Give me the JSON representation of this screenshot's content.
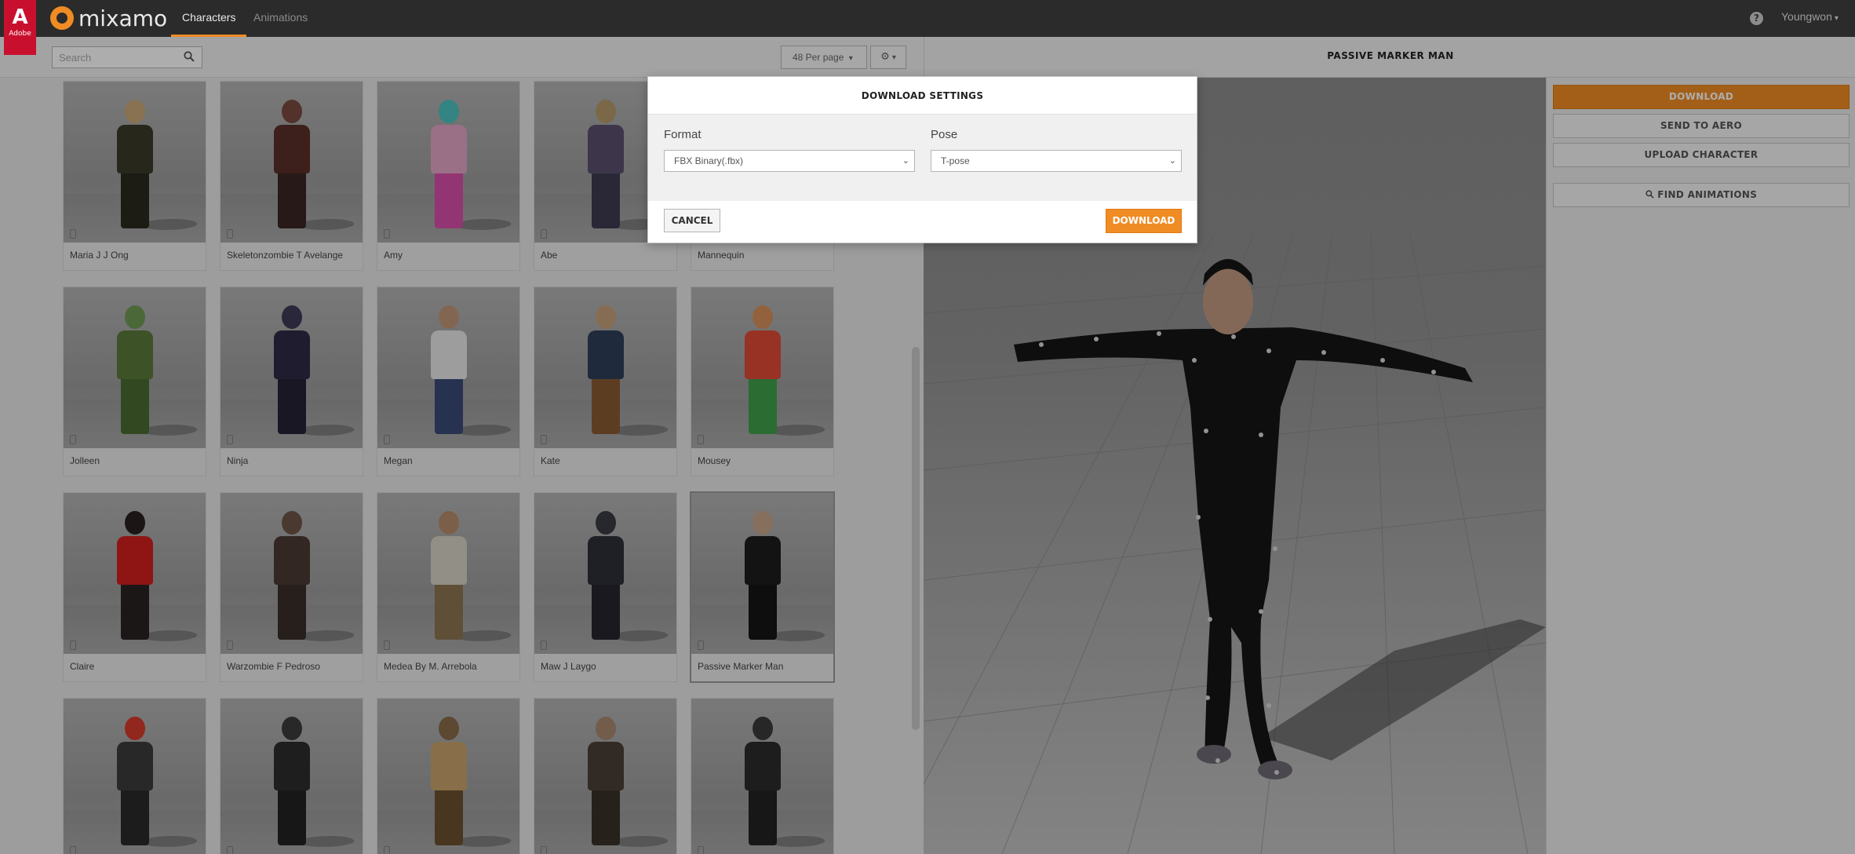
{
  "brand": {
    "adobe_glyph": "A",
    "adobe_word": "Adobe",
    "app_name": "mixamo",
    "accent": "#f08c24"
  },
  "nav": {
    "tabs": [
      {
        "label": "Characters",
        "active": true
      },
      {
        "label": "Animations",
        "active": false
      }
    ],
    "help_glyph": "?",
    "user": "Youngwon",
    "user_caret": "▾"
  },
  "toolbar": {
    "search_placeholder": "Search",
    "per_page": "48 Per page",
    "per_page_caret": "▾",
    "settings_caret": "▾"
  },
  "characters": [
    {
      "name": "Maria J J Ong",
      "colors": [
        "#c9a878",
        "#3a3a2a",
        "#2a2a20"
      ]
    },
    {
      "name": "Skeletonzombie T Avelange",
      "colors": [
        "#7a4a3e",
        "#5b2f28",
        "#3a2622"
      ]
    },
    {
      "name": "Amy",
      "colors": [
        "#4cc3c0",
        "#e3a6c6",
        "#d74fa8"
      ]
    },
    {
      "name": "Abe",
      "colors": [
        "#b49a6b",
        "#5a4e6e",
        "#3f3a52"
      ]
    },
    {
      "name": "Mannequin",
      "colors": [
        "#cfcfcf",
        "#bdbdbd",
        "#a8a8a8"
      ]
    },
    {
      "name": "Jolleen",
      "colors": [
        "#6f9a55",
        "#5a7a3a",
        "#4a6a32"
      ]
    },
    {
      "name": "Ninja",
      "colors": [
        "#3e3a58",
        "#2d2a45",
        "#252236"
      ]
    },
    {
      "name": "Megan",
      "colors": [
        "#c0977a",
        "#e8e8e8",
        "#3a4a78"
      ]
    },
    {
      "name": "Kate",
      "colors": [
        "#c7a07c",
        "#2f3f5a",
        "#8a5a33"
      ]
    },
    {
      "name": "Mousey",
      "colors": [
        "#d7905a",
        "#e04a35",
        "#3fa04a"
      ]
    },
    {
      "name": "Claire",
      "colors": [
        "#2a2020",
        "#d3201f",
        "#2a2222"
      ]
    },
    {
      "name": "Warzombie F Pedroso",
      "colors": [
        "#6e5548",
        "#4a3a34",
        "#3a2f2a"
      ]
    },
    {
      "name": "Medea By M. Arrebola",
      "colors": [
        "#b78d6c",
        "#d8d3c8",
        "#8c7552"
      ]
    },
    {
      "name": "Maw J Laygo",
      "colors": [
        "#3a3a44",
        "#2f2f38",
        "#26262e"
      ]
    },
    {
      "name": "Passive Marker Man",
      "colors": [
        "#c8a48a",
        "#1d1d1d",
        "#151515"
      ],
      "selected": true
    },
    {
      "name": "",
      "colors": [
        "#d63a2c",
        "#3b3b3b",
        "#2a2a2a"
      ]
    },
    {
      "name": "",
      "colors": [
        "#3b3b3b",
        "#2d2d2d",
        "#222222"
      ]
    },
    {
      "name": "",
      "colors": [
        "#8a6a4a",
        "#c9a46c",
        "#6a5030"
      ]
    },
    {
      "name": "",
      "colors": [
        "#a88870",
        "#4a3f36",
        "#3a322a"
      ]
    },
    {
      "name": "",
      "colors": [
        "#3a3a3a",
        "#2b2b2b",
        "#222222"
      ]
    }
  ],
  "viewer": {
    "character_title": "PASSIVE MARKER MAN"
  },
  "side_panel": {
    "download": "DOWNLOAD",
    "send_to_aero": "SEND TO AERO",
    "upload_character": "UPLOAD CHARACTER",
    "find_animations": "FIND ANIMATIONS",
    "find_icon": "🔍"
  },
  "modal": {
    "title": "DOWNLOAD SETTINGS",
    "format_label": "Format",
    "format_value": "FBX Binary(.fbx)",
    "pose_label": "Pose",
    "pose_value": "T-pose",
    "chevron": "⌄",
    "cancel": "CANCEL",
    "download": "DOWNLOAD"
  }
}
